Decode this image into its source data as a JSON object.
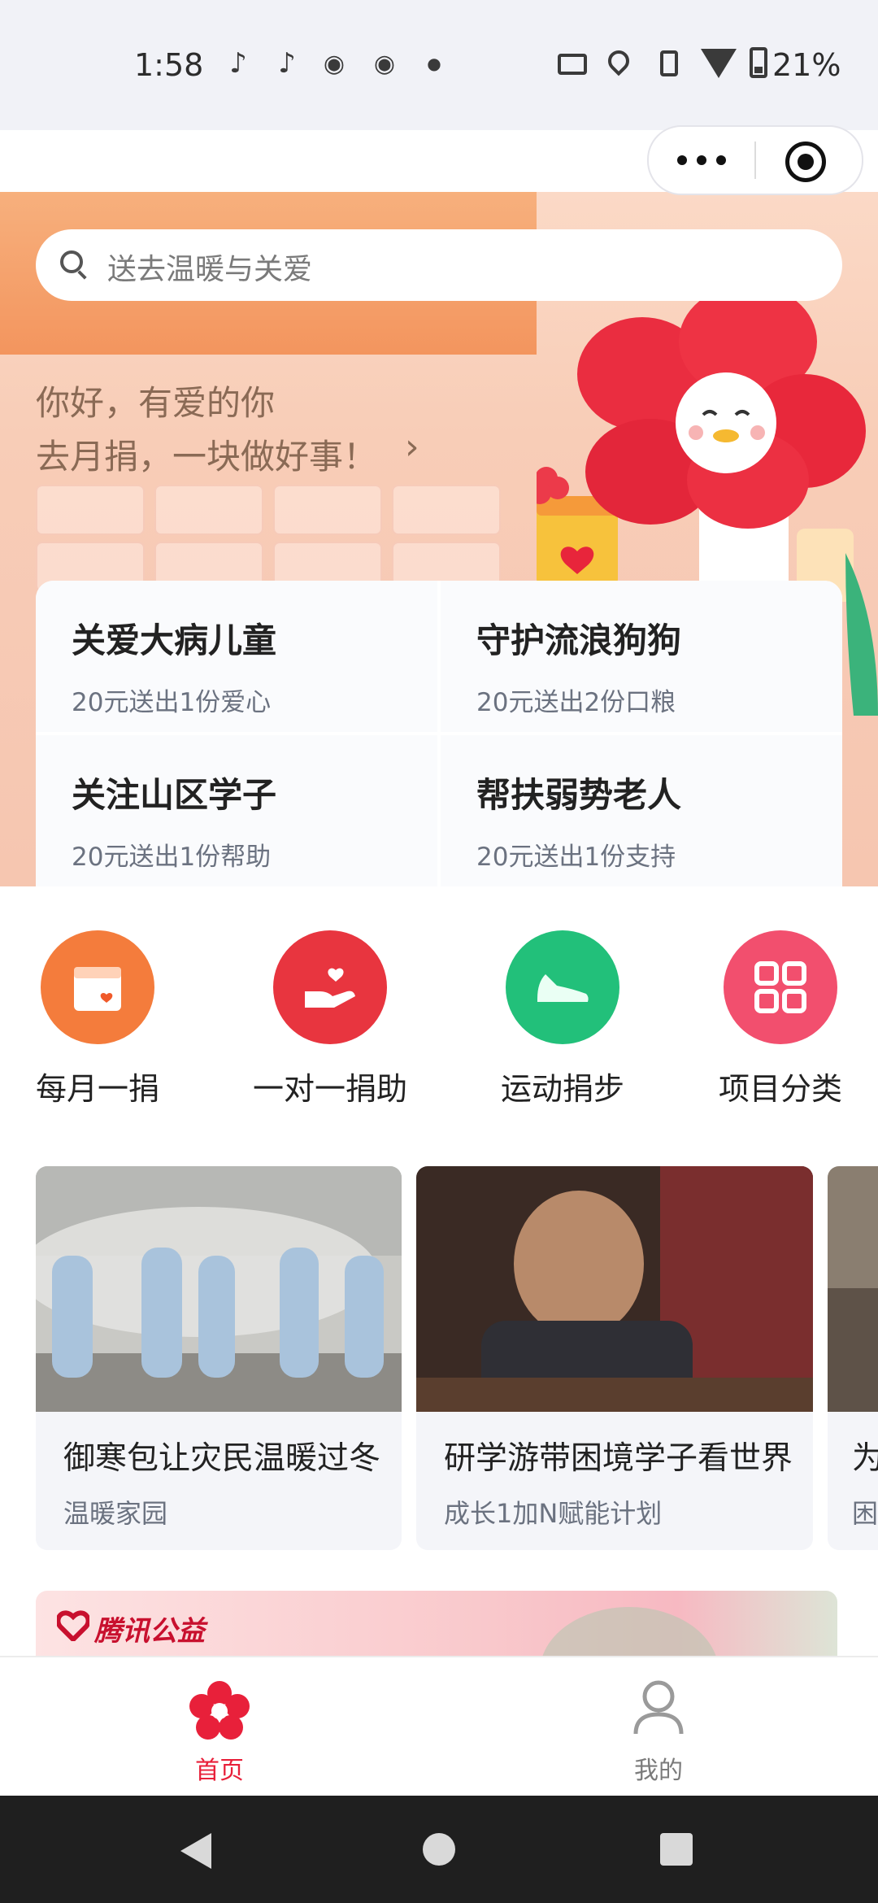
{
  "status_bar": {
    "time": "1:58",
    "battery": "21%",
    "icons": [
      "tiktok-icon",
      "tiktok-icon",
      "weibo-icon",
      "weibo-icon",
      "dot-icon",
      "cast-icon",
      "location-icon",
      "vibrate-icon",
      "wifi-icon",
      "battery-icon"
    ]
  },
  "capsule": {
    "more_icon": "more-dots-icon",
    "close_icon": "target-close-icon"
  },
  "search": {
    "placeholder": "送去温暖与关爱"
  },
  "hero": {
    "greeting_line1": "你好，有爱的你",
    "greeting_line2": "去月捐，一块做好事！",
    "arrow": "›",
    "causes": [
      {
        "title": "关爱大病儿童",
        "subtitle": "20元送出1份爱心"
      },
      {
        "title": "守护流浪狗狗",
        "subtitle": "20元送出2份口粮"
      },
      {
        "title": "关注山区学子",
        "subtitle": "20元送出1份帮助"
      },
      {
        "title": "帮扶弱势老人",
        "subtitle": "20元送出1份支持"
      }
    ]
  },
  "quick_entries": [
    {
      "label": "每月一捐",
      "icon": "calendar-icon",
      "color": "#f47c3c"
    },
    {
      "label": "一对一捐助",
      "icon": "heart-hand-icon",
      "color": "#e8353f"
    },
    {
      "label": "运动捐步",
      "icon": "shoe-icon",
      "color": "#22c07a"
    },
    {
      "label": "项目分类",
      "icon": "grid-icon",
      "color": "#f24f6e"
    }
  ],
  "projects": [
    {
      "title": "御寒包让灾民温暖过冬",
      "subtitle": "温暖家园"
    },
    {
      "title": "研学游带困境学子看世界",
      "subtitle": "成长1加N赋能计划"
    },
    {
      "title": "为",
      "subtitle": "困"
    }
  ],
  "promo": {
    "logo": "腾讯公益"
  },
  "tabbar": [
    {
      "label": "首页",
      "icon": "flower-icon",
      "active": true
    },
    {
      "label": "我的",
      "icon": "person-icon",
      "active": false
    }
  ],
  "colors": {
    "accent": "#e8203a",
    "inactive": "#7b7b7b"
  }
}
